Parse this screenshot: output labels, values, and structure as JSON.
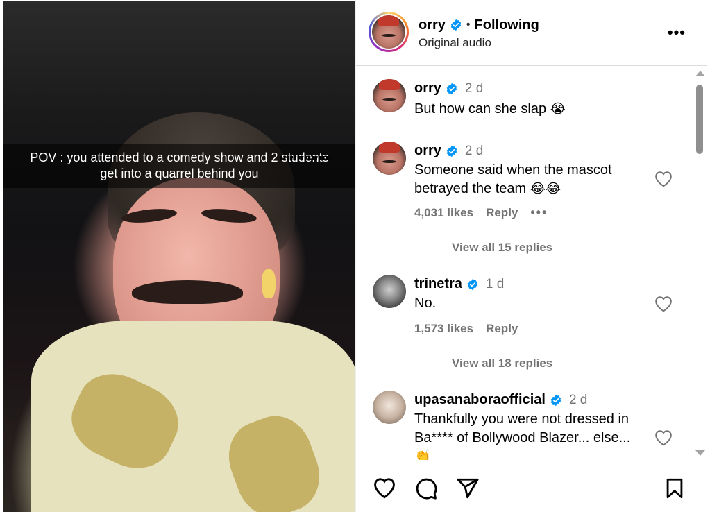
{
  "media": {
    "caption_line1": "POV : you attended to a comedy show and 2",
    "caption_struck": "students",
    "caption_line2": "get into a quarrel behind you"
  },
  "header": {
    "username": "orry",
    "separator": "•",
    "follow_status": "Following",
    "audio": "Original audio",
    "more": "•••"
  },
  "comments": [
    {
      "username": "orry",
      "time": "2 d",
      "text": "But how can she slap",
      "emoji": "😭"
    },
    {
      "username": "orry",
      "time": "2 d",
      "text_line1": "Someone said when the mascot",
      "text_line2": "betrayed the team",
      "emoji": "😂😂",
      "likes": "4,031 likes",
      "reply": "Reply",
      "more": "•••",
      "view_replies": "View all 15 replies"
    },
    {
      "username": "trinetra",
      "time": "1 d",
      "text": "No.",
      "likes": "1,573 likes",
      "reply": "Reply",
      "view_replies": "View all 18 replies"
    },
    {
      "username": "upasanaboraofficial",
      "time": "2 d",
      "text_line1": "Thankfully you were not dressed in",
      "text_line2": "Ba**** of Bollywood Blazer... else...",
      "emoji": "👏"
    }
  ],
  "colors": {
    "verified": "#0095f6",
    "muted_text": "#737373",
    "divider": "#dbdbdb"
  },
  "icons": [
    "heart-icon",
    "comment-icon",
    "share-icon",
    "bookmark-icon",
    "verified-badge-icon",
    "more-options-icon"
  ]
}
